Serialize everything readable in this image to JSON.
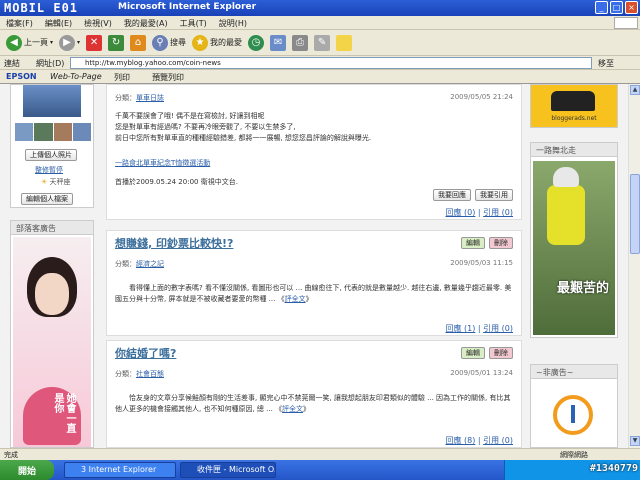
{
  "window": {
    "logo_text": "MOBIL E01",
    "title": "Microsoft Internet Explorer",
    "buttons": [
      "_",
      "□",
      "×"
    ]
  },
  "menu": [
    "檔案(F)",
    "編輯(E)",
    "檢視(V)",
    "我的最愛(A)",
    "工具(T)",
    "說明(H)"
  ],
  "toolbar": {
    "back_label": "上一頁",
    "search_label": "搜尋",
    "favorites_label": "我的最愛"
  },
  "address": {
    "link_label": "連結",
    "address_label": "網址(D)",
    "url": "http://tw.myblog.yahoo.com/coin-news",
    "go_label": "移至"
  },
  "linkbar": {
    "epson": "EPSON",
    "web_to_page": "Web-To-Page",
    "print": "列印",
    "preview": "預覽列印"
  },
  "sidebar": {
    "upload_button": "上傳個人照片",
    "status_link": "整修暫停",
    "weather": "天秤座",
    "edit_profile": "編輯個人檔案",
    "ad_header": "部落客廣告",
    "ad_text": "她會一直是你"
  },
  "posts": [
    {
      "category_label": "分類：",
      "category": "單車日誌",
      "date": "2009/05/05 21:24",
      "lines": [
        "千萬不要誤會了哦! 偶不是在寫檢討, 好讓到相呢",
        "您是對單車有經過嗎? 不要再冷眼旁觀了, 不要以生禁多了,",
        "前日中您所有對單車直的種種經驗錯差, 都將一一展暢, 想您您昌評論的解說與曝光."
      ],
      "event_link": "一路食北單車紀念T恤徵選活動",
      "footer": "首播於2009.05.24 20:00 衛視中文台.",
      "actions": [
        "我要回應",
        "我要引用"
      ],
      "reply": "回應 (0)",
      "cite": "引用 (0)"
    },
    {
      "title": "想賺錢, 印鈔票比較快!?",
      "edit": "編輯",
      "delete": "刪除",
      "category_label": "分類：",
      "category": "經濟之記",
      "date": "2009/05/03 11:15",
      "text": "看得懂上面的數字表嗎? 看不懂沒關係, 看圖形也可以 ... 曲線愈往下, 代表的就是數量越少. 越往右邊, 數量幾乎趨近最零. 美國五分與十分幣, 屏本就是不被收藏者要愛的幣種 ... 《",
      "more": "評全文",
      "reply": "回應 (1)",
      "cite": "引用 (0)"
    },
    {
      "title": "你結婚了嗎?",
      "edit": "編輯",
      "delete": "刪除",
      "category_label": "分類：",
      "category": "社會百態",
      "date": "2009/05/01 13:24",
      "text": "恰友身的文章分享候鮭顏有剛的生活差事, 顯完心中不禁莞爾一笑, 讓我想起朋友印君類似的體驗 ... 因為工作的關係, 有比其他人更多的機會接觸其他人, 也不知何種原因, 總 ... 《",
      "more": "評全文",
      "reply": "回應 (8)",
      "cite": "引用 (0)"
    }
  ],
  "right": {
    "badge_text": "bloggerads.net",
    "section1": "一路舞北走",
    "photo_text": "最艱苦的",
    "section2": "~非廣告~"
  },
  "status": {
    "text": "完成",
    "zone": "網際網路"
  },
  "taskbar": {
    "start": "開始",
    "tasks": [
      "3 Internet Explorer",
      "收件匣 - Microsoft O..."
    ]
  },
  "watermark": "#1340779",
  "colors": {
    "link": "#2b5ea8",
    "title_blue": "#3d6f9c",
    "xp_blue": "#2456c8"
  }
}
